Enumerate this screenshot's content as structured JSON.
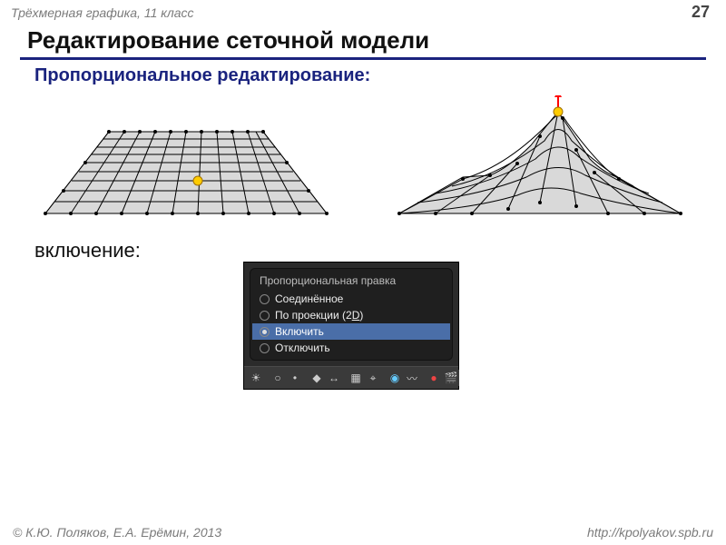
{
  "header": {
    "course": "Трёхмерная графика, 11 класс",
    "page": "27"
  },
  "title": "Редактирование сеточной модели",
  "subtitle": "Пропорциональное редактирование:",
  "enable_label": "включение:",
  "panel": {
    "title": "Пропорциональная правка",
    "items": [
      {
        "label": "Соединённое",
        "selected": false,
        "hotkey": ""
      },
      {
        "label_prefix": "По проекции (2",
        "hotkey_letter": "D",
        "label_suffix": ")",
        "selected": false
      },
      {
        "label": "Включить",
        "selected": true
      },
      {
        "label": "Отключить",
        "selected": false
      }
    ]
  },
  "toolbar_icons": [
    "sun-icon",
    "circle-icon",
    "dot-icon",
    "pivot-icon",
    "arrows-icon",
    "grid-icon",
    "snap-icon",
    "sphere-icon",
    "curve-icon",
    "record-icon",
    "film-icon"
  ],
  "footer": {
    "copyright": "© К.Ю. Поляков, Е.А. Ерёмин, 2013",
    "url": "http://kpolyakov.spb.ru"
  }
}
